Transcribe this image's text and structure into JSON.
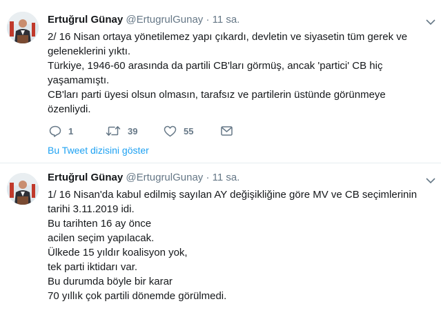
{
  "tweets": [
    {
      "name": "Ertuğrul Günay",
      "handle": "@ErtugrulGunay",
      "separator": "·",
      "time": "11 sa.",
      "lines": [
        "2/ 16 Nisan ortaya yönetilemez yapı çıkardı, devletin ve siyasetin tüm gerek ve",
        "geleneklerini yıktı.",
        "Türkiye, 1946-60 arasında da partili CB'ları görmüş, ancak  'partici' CB hiç",
        "yaşamamıştı.",
        "CB'ları parti üyesi olsun olmasın, tarafsız ve partilerin üstünde görünmeye",
        "özenliydi."
      ],
      "reply_count": "1",
      "retweet_count": "39",
      "like_count": "55",
      "thread_link": "Bu Tweet dizisini göster"
    },
    {
      "name": "Ertuğrul Günay",
      "handle": "@ErtugrulGunay",
      "separator": "·",
      "time": "11 sa.",
      "lines": [
        "1/ 16 Nisan'da kabul edilmiş sayılan AY değişikliğine göre MV ve CB seçimlerinin",
        "tarihi 3.11.2019 idi.",
        "Bu tarihten 16 ay önce",
        "acilen seçim yapılacak.",
        "Ülkede 15 yıldır koalisyon yok,",
        "tek parti iktidarı var.",
        "Bu durumda böyle bir karar",
        "70 yıllık çok partili dönemde görülmedi."
      ]
    }
  ],
  "icons": {
    "reply": "reply-icon",
    "retweet": "retweet-icon",
    "like": "heart-icon",
    "dm": "envelope-icon",
    "caret": "chevron-down-icon"
  },
  "colors": {
    "link": "#1da1f2",
    "muted": "#657786",
    "text": "#14171a",
    "divider": "#e6ecf0"
  }
}
